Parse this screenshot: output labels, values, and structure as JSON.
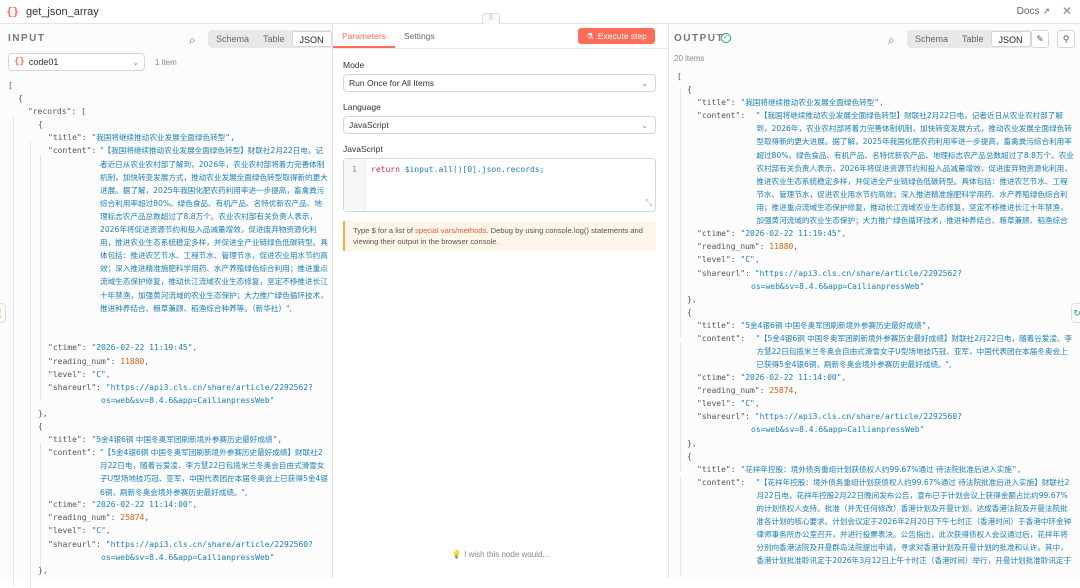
{
  "app": {
    "title": "get_json_array",
    "docs_label": "Docs",
    "close_icon": "close-icon"
  },
  "input": {
    "panel_title": "INPUT",
    "tabs": [
      "Schema",
      "Table",
      "JSON"
    ],
    "active_tab": "JSON",
    "node_name": "code01",
    "item_count": "1 item"
  },
  "output": {
    "panel_title": "OUTPUT",
    "tabs": [
      "Schema",
      "Table",
      "JSON"
    ],
    "active_tab": "JSON",
    "item_count": "20 items"
  },
  "params": {
    "tab_parameters": "Parameters",
    "tab_settings": "Settings",
    "execute_label": "Execute step",
    "mode_label": "Mode",
    "mode_value": "Run Once for All Items",
    "language_label": "Language",
    "language_value": "JavaScript",
    "js_label": "JavaScript",
    "code_line_number": "1",
    "code_kw": "return",
    "code_rest": " $input.all()[0].json.records;",
    "hint_pre": "Type $ for a list of ",
    "hint_link": "special vars/methods",
    "hint_post": ". Debug by using console.log() statements and viewing their output in the browser console.",
    "wish": "I wish this node would..."
  },
  "records": [
    {
      "title": "我国将继续推动农业发展全面绿色转型",
      "content_in": "【我国将继续推动农业发展全面绿色转型】财联社2月22日电，记者近日从农业农村部了解到，2026年，农业农村部将着力完善体制机制，加快转变发展方式，推动农业发展全面绿色转型取得新的更大进展。据了解，2025年我国化肥农药利用率进一步提高，畜禽粪污综合利用率超过80%。绿色食品、有机产品、名特优新农产品、地理标志农产品总数超过了8.8万个。农业农村部有关负责人表示，2026年将促进资源节约和投入品减量增效，促进废弃物资源化利用，推进农业生态系统稳定多样，并促进全产业链绿色低碳转型。具体包括：推进农艺节水、工程节水、管理节水，促进农业用水节约高效；深入推进精准施肥科学用药、水产养殖绿色综合利用；推进重点流域生态保护修复，推动长江流域农业生态修复，坚定不移推进长江十年禁渔，加强黄河流域的农业生态保护；大力推广绿色循环技术，推进种养结合、粮草兼顾、稻渔综合种养等。（新华社）",
      "content_out": "【我国将继续推动农业发展全面绿色转型】财联社2月22日电，记者近日从农业农村部了解到，2026年，农业农村部将着力完善体制机制，加快转变发展方式，推动农业发展全面绿色转型取得新的更大进展。据了解，2025年我国化肥农药利用率进一步提高，畜禽粪污综合利用率超过80%。绿色食品、有机产品、名特优新农产品、地理标志农产品总数超过了8.8万个。农业农村部有关负责人表示，2026年将促进资源节约和投入品减量增效，促进废弃物资源化利用，推进农业生态系统稳定多样，并促进全产业链绿色低碳转型。具体包括：推进农艺节水、工程节水、管理节水，促进农业用水节约高效；深入推进精准施肥科学用药、水产养殖绿色综合利用；推进重点流域生态保护修复，推动长江流域农业生态修复，坚定不移推进长江十年禁渔，加强黄河流域的农业生态保护；大力推广绿色循环技术，推进种养结合、粮草兼顾、稻渔综合种养等。（新华社）",
      "ctime": "2026-02-22 11:19:45",
      "reading_num": "11880",
      "level": "C",
      "shareurl_1": "https://api3.cls.cn/share/article/2292562?",
      "shareurl_2": "os=web&sv=8.4.6&app=CailianpressWeb"
    },
    {
      "title": "5金4银6铜 中国冬奥军团刷新境外参赛历史最好成绩",
      "content": "【5金4银6铜 中国冬奥军团刷新境外参赛历史最好成绩】财联社2月22日电，随着谷爱凌、李方慧22日包揽米兰冬奥会自由式滑雪女子U型场地技巧冠、亚军，中国代表团在本届冬奥会上已获得5金4银6铜，刷新冬奥会境外参赛历史最好成绩。",
      "ctime": "2026-02-22 11:14:00",
      "reading_num": "25874",
      "level": "C",
      "shareurl_1": "https://api3.cls.cn/share/article/2292560?",
      "shareurl_2": "os=web&sv=8.4.6&app=CailianpressWeb"
    },
    {
      "title": "花祥年控股：境外债务重组计划获债权人约99.67%通过 待法院批准后进入实施",
      "content_in": "【花祥年控股：境外债务重组计划获债权人约99.67%通过 待法院批准",
      "content_out": "【花祥年控股：境外债务重组计划获债权人约99.67%通过 待法院批准后进入实施】财联社2月22日电，花祥年控股2月22日晚间发布公告，宣布已于计划会议上获得金额占比约99.67%的计划债权人支持。批准（并无任何修改）香港计划及开曼计划，达成香港法院及开曼法院批准各计划的核心要求。计划会议定于2026年2月20日下午七时正（香港时间）于香港中环金钟律师事务所办公室召开，并进行投票表决。公告指出，此次获得债权人会议通过后，花祥年将分别向香港法院及开曼群岛法院提出申请，寻求对香港计划及开曼计划的批准和认许。其中，香港计划批准聆讯定于2026年3月12日上午十时正（香港时间）举行，开曼计划批准聆讯定于同日下午十时三十分"
    }
  ]
}
